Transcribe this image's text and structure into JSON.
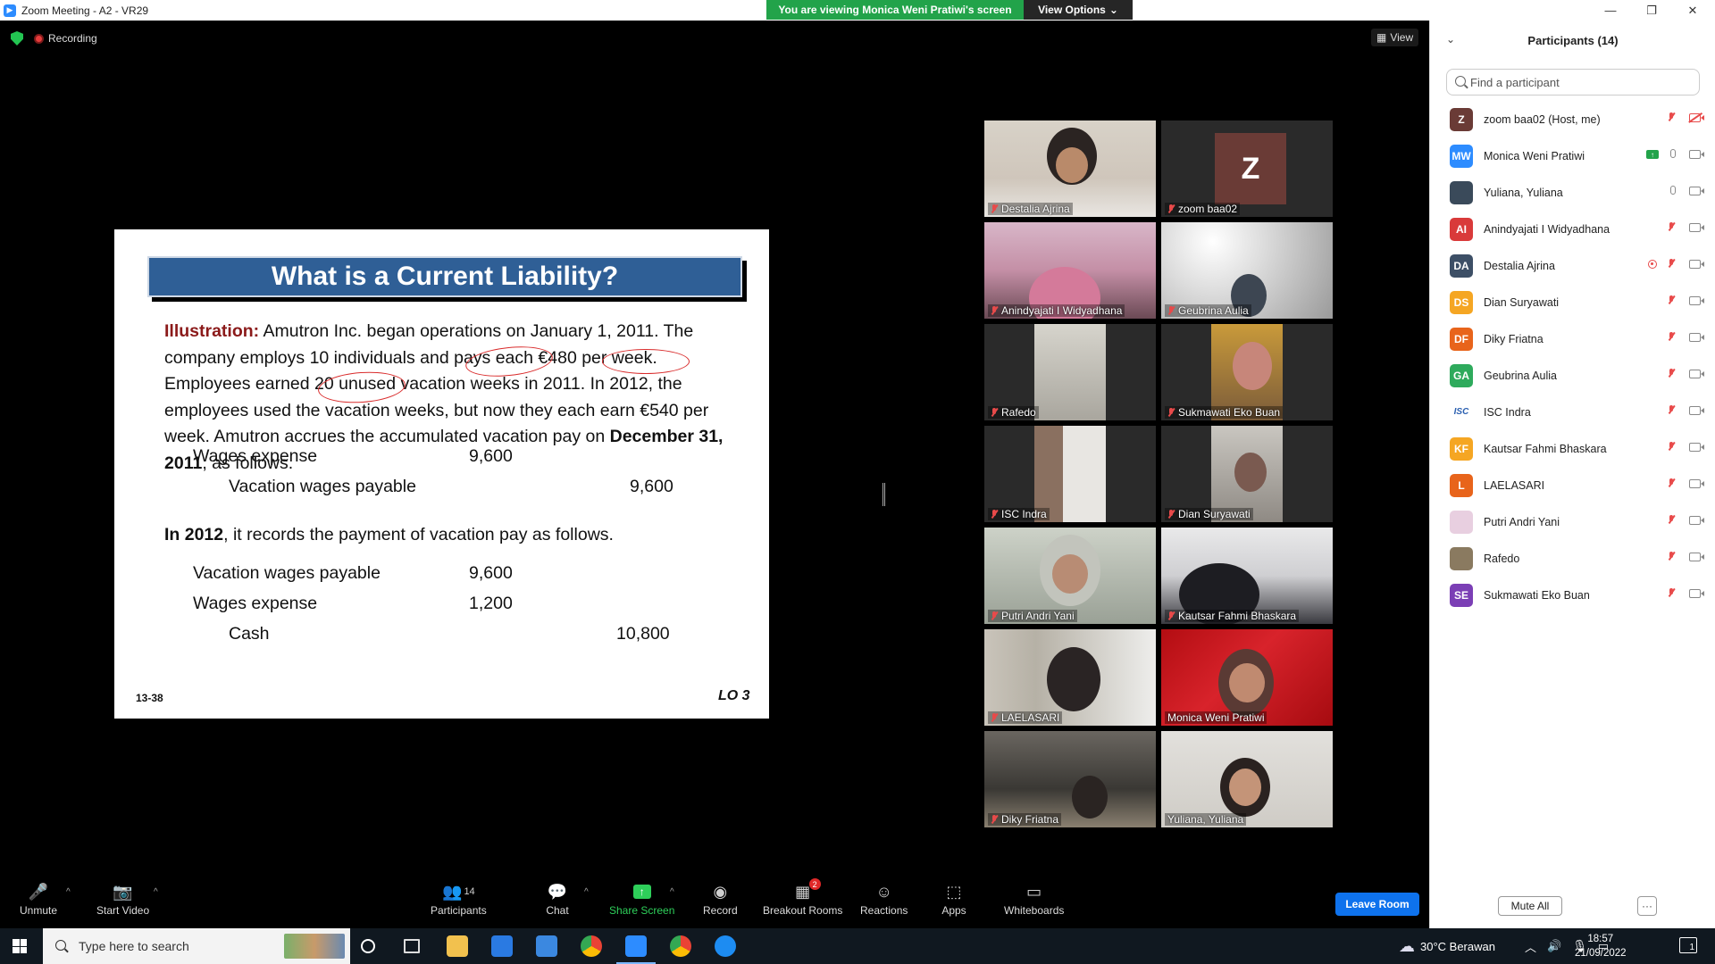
{
  "window": {
    "title": "Zoom Meeting - A2 - VR29",
    "viewing_banner": "You are viewing Monica Weni Pratiwi's screen",
    "view_options": "View Options",
    "minimize": "—",
    "restore": "❐",
    "close": "✕"
  },
  "meeting": {
    "recording_label": "Recording",
    "view_label": "View"
  },
  "slide": {
    "title": "What is a Current Liability?",
    "illustration_label": "Illustration:",
    "paragraph": " Amutron Inc. began operations on January 1, 2011. The company employs 10 individuals and pays each €480 per week. Employees earned 20 unused vacation weeks in 2011. In 2012, the employees used the vacation weeks, but now they each earn €540 per week. Amutron accrues the accumulated vacation pay on ",
    "date_bold": "December 31, 2011",
    "paragraph_end": ", as follows.",
    "entry1": [
      {
        "account": "Wages expense",
        "debit": "9,600",
        "credit": ""
      },
      {
        "account": "Vacation wages payable",
        "debit": "",
        "credit": "9,600"
      }
    ],
    "year_bold": "In 2012",
    "sentence2": ", it records the payment of vacation pay as follows.",
    "entry2": [
      {
        "account": "Vacation wages payable",
        "debit": "9,600",
        "credit": ""
      },
      {
        "account": "Wages expense",
        "debit": "1,200",
        "credit": ""
      },
      {
        "account": "Cash",
        "debit": "",
        "credit": "10,800"
      }
    ],
    "page_code": "13-38",
    "lo": "LO 3"
  },
  "gallery": [
    {
      "name": "Destalia Ajrina",
      "muted": true
    },
    {
      "name": "zoom baa02",
      "muted": true,
      "avatar_letter": "Z"
    },
    {
      "name": "Anindyajati I Widyadhana",
      "muted": true
    },
    {
      "name": "Geubrina Aulia",
      "muted": true
    },
    {
      "name": "Rafedo",
      "muted": true
    },
    {
      "name": "Sukmawati Eko Buan",
      "muted": true
    },
    {
      "name": "ISC Indra",
      "muted": true
    },
    {
      "name": "Dian Suryawati",
      "muted": true
    },
    {
      "name": "Putri Andri Yani",
      "muted": true
    },
    {
      "name": "Kautsar Fahmi Bhaskara",
      "muted": true
    },
    {
      "name": "LAELASARI",
      "muted": true
    },
    {
      "name": "Monica Weni Pratiwi",
      "muted": false,
      "active": true
    },
    {
      "name": "Diky Friatna",
      "muted": true
    },
    {
      "name": "Yuliana, Yuliana",
      "muted": false
    }
  ],
  "toolbar": {
    "unmute": "Unmute",
    "start_video": "Start Video",
    "participants": "Participants",
    "participants_count": "14",
    "chat": "Chat",
    "share_screen": "Share Screen",
    "record": "Record",
    "breakout_rooms": "Breakout Rooms",
    "breakout_badge": "2",
    "reactions": "Reactions",
    "apps": "Apps",
    "whiteboards": "Whiteboards",
    "leave_room": "Leave Room"
  },
  "panel": {
    "title": "Participants (14)",
    "search_placeholder": "Find a participant",
    "mute_all": "Mute All",
    "more": "···",
    "participants": [
      {
        "initials": "Z",
        "color": "#6a3b36",
        "name": "zoom baa02 (Host, me)",
        "mic": "off",
        "cam": "off"
      },
      {
        "initials": "MW",
        "color": "#2d8cff",
        "name": "Monica Weni Pratiwi",
        "mic": "on",
        "cam": "on",
        "sharing": true
      },
      {
        "initials": "",
        "color": "#3a4a5a",
        "name": "Yuliana, Yuliana",
        "mic": "on",
        "cam": "on"
      },
      {
        "initials": "AI",
        "color": "#d93a3a",
        "name": "Anindyajati I Widyadhana",
        "mic": "off",
        "cam": "on"
      },
      {
        "initials": "DA",
        "color": "#3d4f66",
        "name": "Destalia Ajrina",
        "mic": "off",
        "cam": "on",
        "spotlight": true
      },
      {
        "initials": "DS",
        "color": "#f5a623",
        "name": "Dian Suryawati",
        "mic": "off",
        "cam": "on"
      },
      {
        "initials": "DF",
        "color": "#e8641b",
        "name": "Diky Friatna",
        "mic": "off",
        "cam": "on"
      },
      {
        "initials": "GA",
        "color": "#2eaa5c",
        "name": "Geubrina Aulia",
        "mic": "off",
        "cam": "on"
      },
      {
        "initials": "ISC",
        "color": "#ffffff",
        "name": "ISC Indra",
        "mic": "off",
        "cam": "on"
      },
      {
        "initials": "KF",
        "color": "#f5a623",
        "name": "Kautsar Fahmi Bhaskara",
        "mic": "off",
        "cam": "on"
      },
      {
        "initials": "L",
        "color": "#e8641b",
        "name": "LAELASARI",
        "mic": "off",
        "cam": "on"
      },
      {
        "initials": "",
        "color": "#e8cfe0",
        "name": "Putri Andri Yani",
        "mic": "off",
        "cam": "on"
      },
      {
        "initials": "",
        "color": "#8a7a60",
        "name": "Rafedo",
        "mic": "off",
        "cam": "on"
      },
      {
        "initials": "SE",
        "color": "#7b3fb5",
        "name": "Sukmawati Eko Buan",
        "mic": "off",
        "cam": "on"
      }
    ]
  },
  "taskbar": {
    "search_placeholder": "Type here to search",
    "weather": "30°C  Berawan",
    "time": "18:57",
    "date": "21/09/2022",
    "notifications": "1"
  }
}
